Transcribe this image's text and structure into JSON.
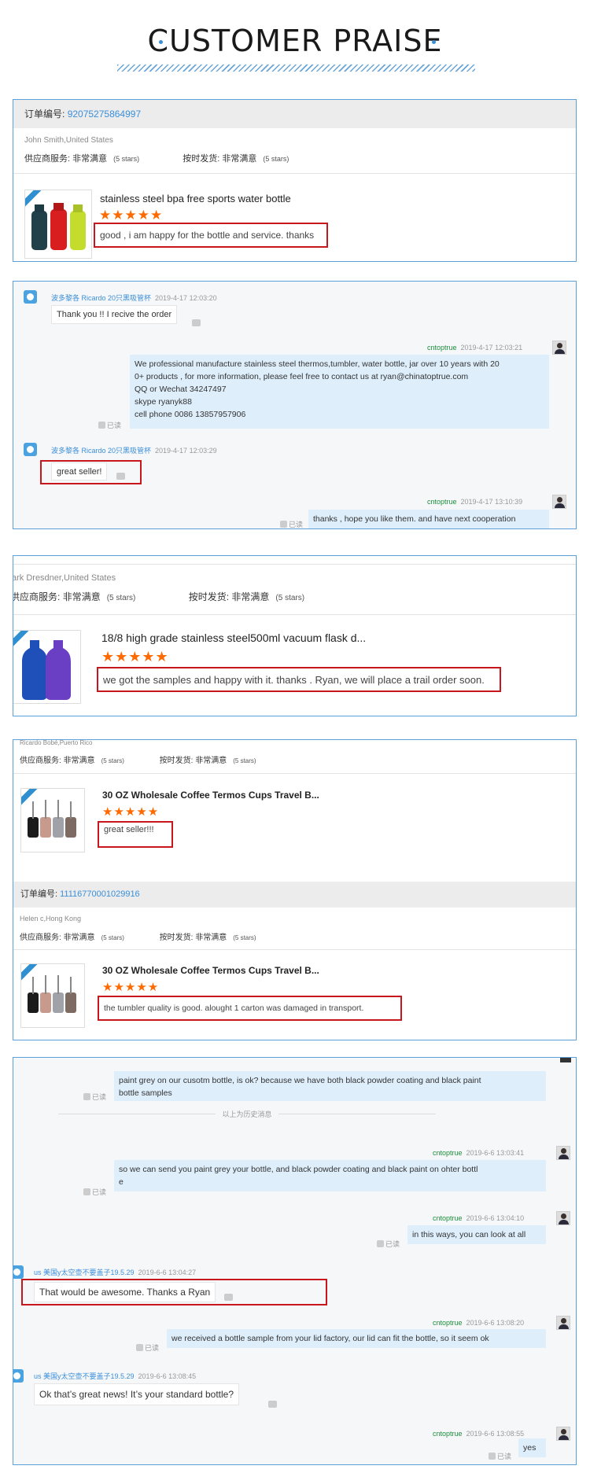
{
  "header": {
    "title": "CUSTOMER PRAISE"
  },
  "labels": {
    "order_no": "订单编号:",
    "supplier_service": "供应商服务:",
    "delivery": "按时发货:",
    "very_satisfied": "非常满意",
    "five_stars": "(5 stars)",
    "read": "已读",
    "history": "以上为历史消息",
    "star_row": "★★★★★"
  },
  "review1": {
    "order_number": "92075275864997",
    "buyer": "John Smith,United States",
    "product": "stainless steel bpa free sports water bottle",
    "comment": "good , i am happy for the bottle and service. thanks"
  },
  "chat1": {
    "m1": {
      "sender": "波多黎各 Ricardo 20只黑吸管杯",
      "time": "2019-4-17 12:03:20",
      "text": "Thank you !! I recive the order"
    },
    "m2": {
      "sender": "cntoptrue",
      "time": "2019-4-17 12:03:21",
      "lines": [
        "We professional manufacture stainless steel thermos,tumbler, water bottle, jar over 10 years with 20",
        "0+ products , for more information, please feel free to contact us at ryan@chinatoptrue.com",
        "QQ or Wechat 34247497",
        " skype ryanyk88",
        "cell phone 0086 13857957906"
      ]
    },
    "m3": {
      "sender": "波多黎各 Ricardo 20只黑吸管杯",
      "time": "2019-4-17 12:03:29",
      "text": "great seller!"
    },
    "m4": {
      "sender": "cntoptrue",
      "time": "2019-4-17 13:10:39",
      "text": "thanks , hope you like them. and have next cooperation"
    }
  },
  "review2": {
    "buyer": "ark Dresdner,United States",
    "service_label": "供应商服务:",
    "product": "18/8 high grade stainless steel500ml vacuum flask d...",
    "comment": "we got the samples and happy with it. thanks . Ryan, we will place  a trail order soon."
  },
  "review3": {
    "buyer": "Ricardo Bobé,Puerto Rico",
    "product": "30 OZ Wholesale Coffee Termos Cups Travel B...",
    "comment": "great seller!!!"
  },
  "review4": {
    "order_number": "11116770001029916",
    "buyer": "Helen c,Hong Kong",
    "product": "30 OZ Wholesale Coffee Termos Cups Travel B...",
    "comment": "the tumbler quality is good. alought 1 carton was damaged in transport."
  },
  "chat2": {
    "m0": {
      "lines": [
        "paint grey on our cusotm bottle, is ok? because we have both black powder coating and black paint",
        " bottle samples"
      ]
    },
    "m1": {
      "sender": "cntoptrue",
      "time": "2019-6-6 13:03:41",
      "lines": [
        "so we can send you paint grey your bottle,  and black powder coating and black paint on ohter bottl",
        "e"
      ]
    },
    "m2": {
      "sender": "cntoptrue",
      "time": "2019-6-6 13:04:10",
      "text": "in this ways, you can look at all"
    },
    "m3": {
      "sender": "us 美国y太空壶不要盖子19.5.29",
      "time": "2019-6-6 13:04:27",
      "text": "That would be awesome. Thanks a Ryan"
    },
    "m4": {
      "sender": "cntoptrue",
      "time": "2019-6-6 13:08:20",
      "text": "we received a bottle sample from your lid factory, our lid can fit the bottle, so it seem ok"
    },
    "m5": {
      "sender": "us 美国y太空壶不要盖子19.5.29",
      "time": "2019-6-6 13:08:45",
      "text": "Ok that’s great news! It’s your standard bottle?"
    },
    "m6": {
      "sender": "cntoptrue",
      "time": "2019-6-6 13:08:55",
      "text": "yes"
    }
  },
  "colors": {
    "accent": "#3b8fd9",
    "frame": "#5ba0d8",
    "highlight": "#c8161d",
    "star": "#ff6a00",
    "bubble": "#deeefb"
  }
}
